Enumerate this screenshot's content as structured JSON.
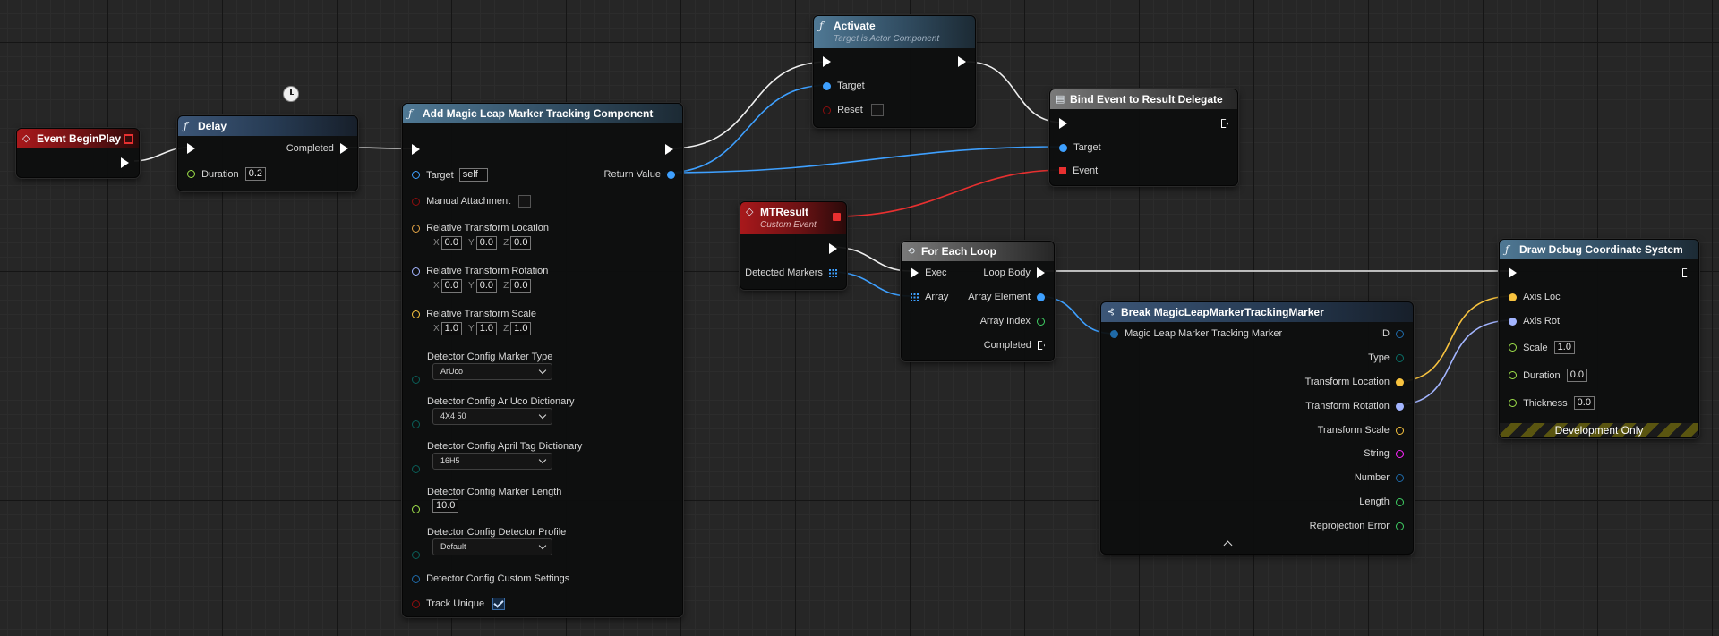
{
  "colors": {
    "exec": "#ffffff",
    "object": "#3ea0ff",
    "bool": "#8c0e0e",
    "float": "#9ee04a",
    "vector": "#f8c33f",
    "rotator": "#a3b5ff",
    "transform": "#e3a446",
    "byte": "#0a5e58",
    "struct": "#1f6aa8",
    "string": "#ff26ff",
    "int": "#1fa2a2",
    "delegate": "#e83030"
  },
  "event_beginplay": {
    "title": "Event BeginPlay"
  },
  "delay": {
    "title": "Delay",
    "completed": "Completed",
    "duration_label": "Duration",
    "duration_value": "0.2"
  },
  "add": {
    "title": "Add Magic Leap Marker Tracking Component",
    "return_value": "Return Value",
    "target_label": "Target",
    "target_value": "self",
    "manual_attachment": "Manual Attachment",
    "rel_loc": "Relative Transform Location",
    "rel_rot": "Relative Transform Rotation",
    "rel_scale": "Relative Transform Scale",
    "x": "X",
    "y": "Y",
    "z": "Z",
    "loc": [
      "0.0",
      "0.0",
      "0.0"
    ],
    "rot": [
      "0.0",
      "0.0",
      "0.0"
    ],
    "scale": [
      "1.0",
      "1.0",
      "1.0"
    ],
    "marker_type": "Detector Config Marker Type",
    "marker_type_value": "ArUco",
    "aruco_dict": "Detector Config Ar Uco Dictionary",
    "aruco_dict_value": "4X4 50",
    "april_dict": "Detector Config April Tag Dictionary",
    "april_dict_value": "16H5",
    "marker_len": "Detector Config Marker Length",
    "marker_len_value": "10.0",
    "profile": "Detector Config Detector Profile",
    "profile_value": "Default",
    "custom": "Detector Config Custom Settings",
    "track_unique": "Track Unique"
  },
  "activate": {
    "title": "Activate",
    "subtitle": "Target is Actor Component",
    "target": "Target",
    "reset": "Reset"
  },
  "bind": {
    "title": "Bind Event to Result Delegate",
    "target": "Target",
    "event": "Event"
  },
  "mtresult": {
    "title": "MTResult",
    "subtitle": "Custom Event",
    "detected": "Detected Markers"
  },
  "foreach": {
    "title": "For Each Loop",
    "exec": "Exec",
    "loop_body": "Loop Body",
    "array": "Array",
    "array_element": "Array Element",
    "array_index": "Array Index",
    "completed": "Completed"
  },
  "break": {
    "title": "Break MagicLeapMarkerTrackingMarker",
    "input": "Magic Leap Marker Tracking Marker",
    "outputs": [
      "ID",
      "Type",
      "Transform Location",
      "Transform Rotation",
      "Transform Scale",
      "String",
      "Number",
      "Length",
      "Reprojection Error"
    ]
  },
  "draw": {
    "title": "Draw Debug Coordinate System",
    "axis_loc": "Axis Loc",
    "axis_rot": "Axis Rot",
    "scale": "Scale",
    "scale_value": "1.0",
    "duration": "Duration",
    "duration_value": "0.0",
    "thickness": "Thickness",
    "thickness_value": "0.0",
    "footer": "Development Only"
  }
}
